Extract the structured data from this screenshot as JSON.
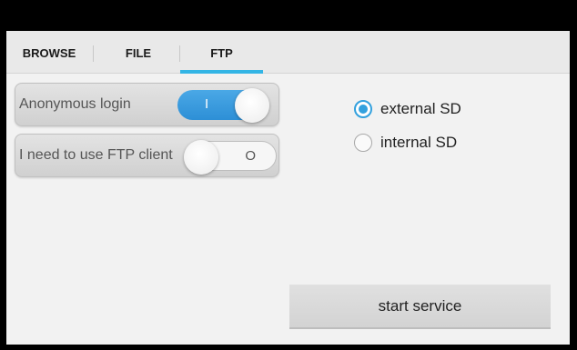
{
  "tabs": {
    "browse": "BROWSE",
    "file": "FILE",
    "ftp": "FTP",
    "active": "ftp",
    "accent_color": "#33b5e5"
  },
  "settings": {
    "anonymous_login": {
      "label": "Anonymous login",
      "state": "on",
      "mark": "I"
    },
    "ftp_client": {
      "label": "I need to use FTP client",
      "state": "off",
      "mark": "O"
    }
  },
  "storage": {
    "options": [
      {
        "label": "external SD",
        "checked": true
      },
      {
        "label": "internal SD",
        "checked": false
      }
    ],
    "radio_color": "#33a1de"
  },
  "actions": {
    "start_label": "start service"
  }
}
